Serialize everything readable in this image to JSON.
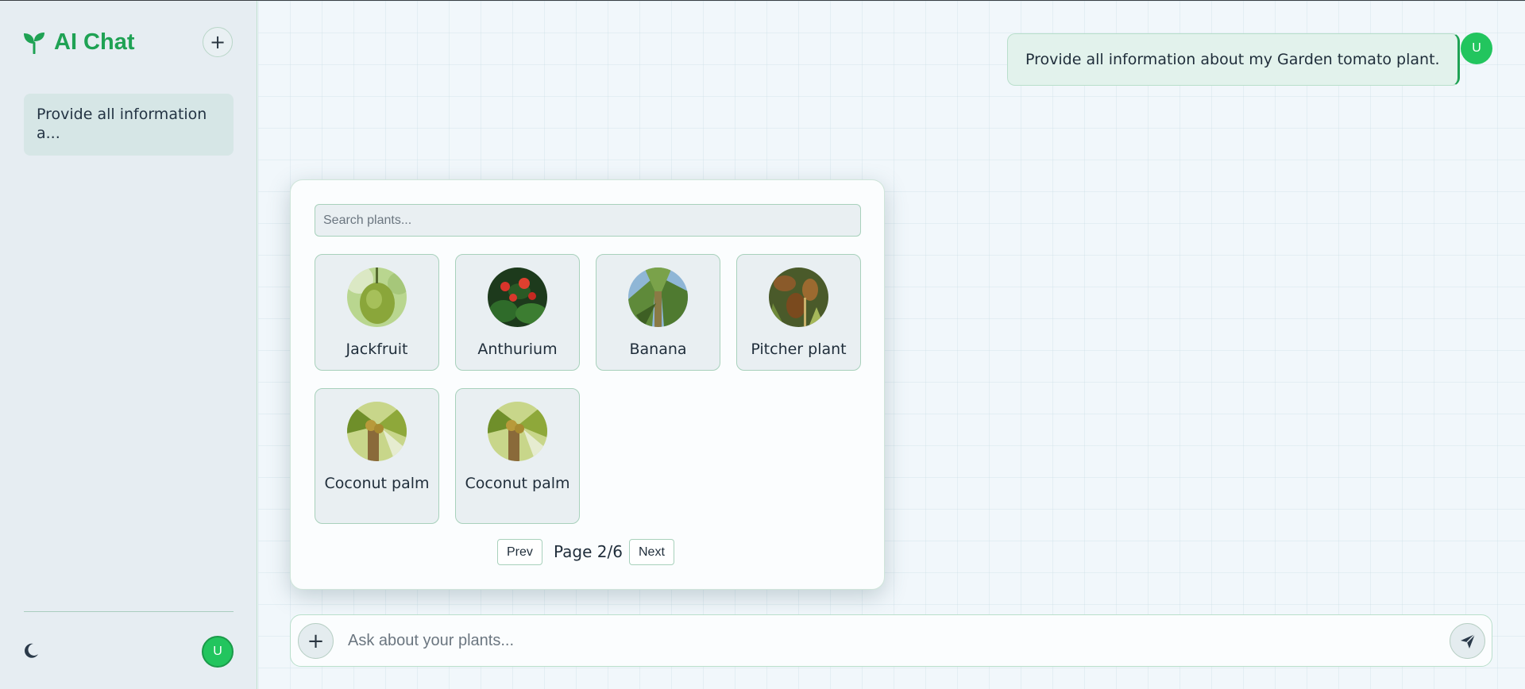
{
  "app": {
    "title": "AI Chat",
    "accent_color": "#1fa254",
    "avatar_color": "#22c55e"
  },
  "sidebar": {
    "new_chat_icon": "plus-icon",
    "history": [
      {
        "label": "Provide all information a..."
      }
    ],
    "theme_toggle_icon": "moon-icon",
    "user_avatar_initial": "U"
  },
  "chat": {
    "messages": [
      {
        "role": "user",
        "text": "Provide all information about my Garden tomato plant.",
        "avatar_initial": "U"
      }
    ]
  },
  "plant_picker": {
    "search_placeholder": "Search plants...",
    "plants": [
      {
        "name": "Jackfruit",
        "image": "jackfruit-photo"
      },
      {
        "name": "Anthurium",
        "image": "anthurium-photo"
      },
      {
        "name": "Banana",
        "image": "banana-photo"
      },
      {
        "name": "Pitcher plant",
        "image": "pitcher-plant-photo"
      },
      {
        "name": "Coconut palm",
        "image": "coconut-palm-photo"
      },
      {
        "name": "Coconut palm",
        "image": "coconut-palm-photo"
      }
    ],
    "pagination": {
      "prev_label": "Prev",
      "page_label": "Page 2/6",
      "next_label": "Next",
      "current": 2,
      "total": 6
    }
  },
  "composer": {
    "placeholder": "Ask about your plants...",
    "attach_icon": "plus-icon",
    "send_icon": "paper-plane-icon"
  }
}
